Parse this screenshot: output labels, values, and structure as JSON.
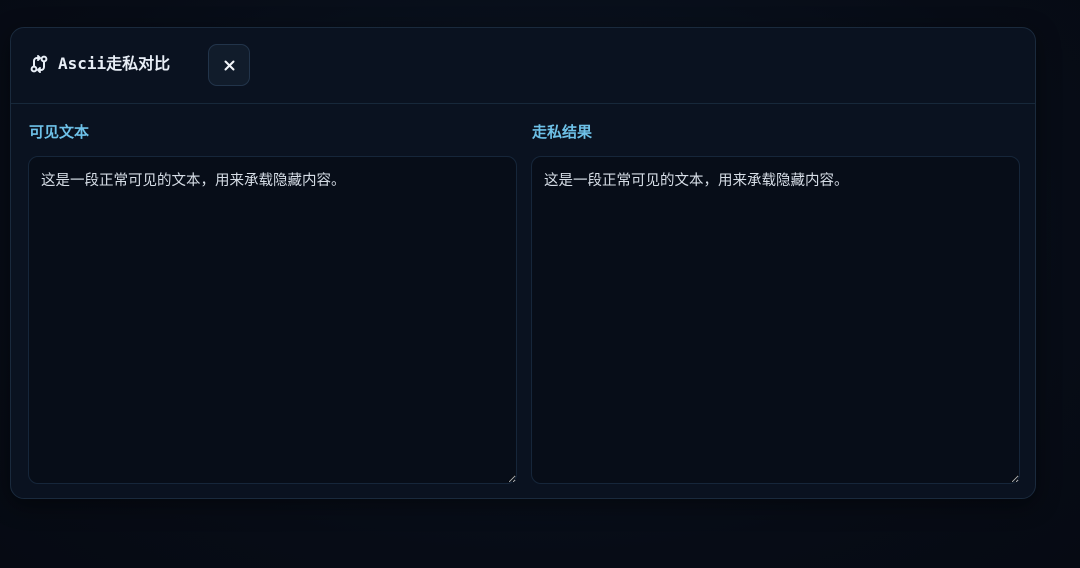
{
  "dialog": {
    "title": "Ascii走私对比",
    "title_icon": "route-icon",
    "close_label": "×"
  },
  "panels": {
    "left": {
      "label": "可见文本",
      "value": "这是一段正常可见的文本，用来承载隐藏内容。"
    },
    "right": {
      "label": "走私结果",
      "value": "这是一段正常可见的文本，用来承载隐藏内容。"
    }
  },
  "colors": {
    "background": "#070d17",
    "dialog_bg": "#0a1220",
    "border": "#1a2a3d",
    "label_accent": "#6ec1e8",
    "text": "#d6dde6"
  }
}
